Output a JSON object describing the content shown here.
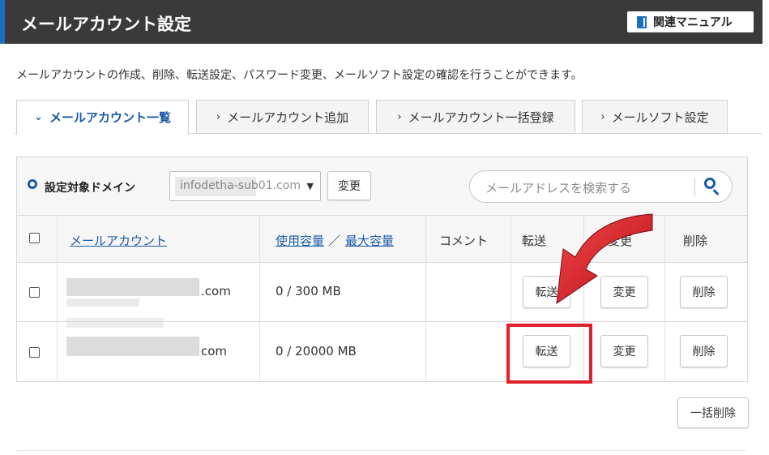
{
  "header": {
    "title": "メールアカウント設定",
    "manual_label": "関連マニュアル"
  },
  "description": "メールアカウントの作成、削除、転送設定、パスワード変更、メールソフト設定の確認を行うことができます。",
  "tabs": [
    {
      "label": "メールアカウント一覧",
      "active": true
    },
    {
      "label": "メールアカウント追加",
      "active": false
    },
    {
      "label": "メールアカウント一括登録",
      "active": false
    },
    {
      "label": "メールソフト設定",
      "active": false
    }
  ],
  "filter": {
    "label": "設定対象ドメイン",
    "domain_value": "infodetha-sub01.com",
    "change_button": "変更"
  },
  "search": {
    "placeholder": "メールアドレスを検索する"
  },
  "table": {
    "headers": {
      "account": "メールアカウント",
      "usage": "使用容量",
      "separator": "／",
      "max": "最大容量",
      "comment": "コメント",
      "forward": "転送",
      "change": "変更",
      "delete": "削除"
    },
    "rows": [
      {
        "email_suffix": ".com",
        "usage": "0 / 300 MB",
        "forward": "転送",
        "change": "変更",
        "delete": "削除"
      },
      {
        "email_suffix": "com",
        "usage": "0 / 20000 MB",
        "forward": "転送",
        "change": "変更",
        "delete": "削除"
      }
    ]
  },
  "bulk_delete": "一括削除",
  "colors": {
    "accent": "#1a5aa6",
    "header_bg": "#3a3a3a",
    "highlight": "#e0202b"
  }
}
